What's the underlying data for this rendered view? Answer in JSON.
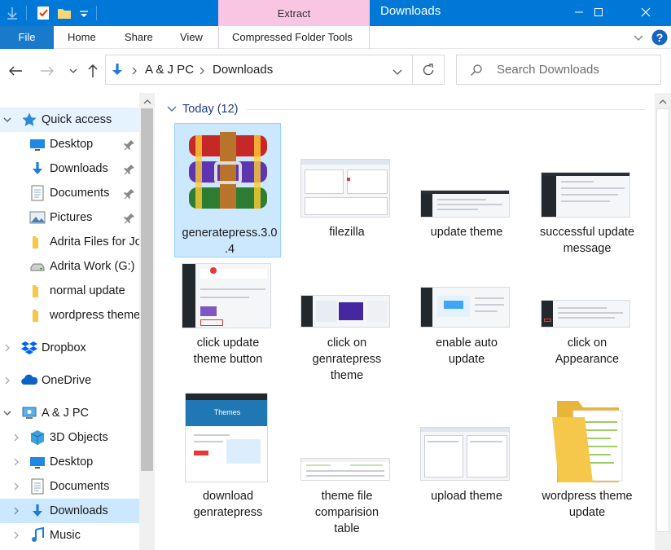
{
  "window": {
    "title": "Downloads",
    "context_tab": "Extract",
    "controls": {
      "minimize": "minimize-icon",
      "maximize": "maximize-icon",
      "close": "close-icon"
    }
  },
  "ribbon": {
    "file": "File",
    "tabs": [
      "Home",
      "Share",
      "View"
    ],
    "context_tab": "Compressed Folder Tools"
  },
  "address": {
    "path": [
      "A & J PC",
      "Downloads"
    ],
    "search_placeholder": "Search Downloads"
  },
  "nav": {
    "quick_access": "Quick access",
    "items": [
      {
        "label": "Desktop",
        "icon": "desktop-icon",
        "pinned": true
      },
      {
        "label": "Downloads",
        "icon": "download-arrow-icon",
        "pinned": true
      },
      {
        "label": "Documents",
        "icon": "documents-icon",
        "pinned": true
      },
      {
        "label": "Pictures",
        "icon": "pictures-icon",
        "pinned": true
      },
      {
        "label": "Adrita Files for Jo",
        "icon": "folder-icon",
        "pinned": false
      },
      {
        "label": "Adrita Work (G:)",
        "icon": "drive-icon",
        "pinned": false
      },
      {
        "label": "normal update",
        "icon": "folder-icon",
        "pinned": false
      },
      {
        "label": "wordpress theme",
        "icon": "folder-icon",
        "pinned": false
      }
    ],
    "dropbox": "Dropbox",
    "onedrive": "OneDrive",
    "this_pc": "A & J PC",
    "pc_items": [
      {
        "label": "3D Objects",
        "icon": "3d-objects-icon"
      },
      {
        "label": "Desktop",
        "icon": "desktop-icon"
      },
      {
        "label": "Documents",
        "icon": "documents-icon"
      },
      {
        "label": "Downloads",
        "icon": "download-arrow-icon"
      },
      {
        "label": "Music",
        "icon": "music-icon"
      }
    ]
  },
  "content": {
    "group": "Today (12)",
    "files": [
      {
        "name": "generatepress.3.0.4",
        "lines": [
          "generatepress.3.0",
          ".4"
        ],
        "kind": "winrar"
      },
      {
        "name": "filezilla",
        "lines": [
          "filezilla"
        ],
        "kind": "shot-light"
      },
      {
        "name": "update theme",
        "lines": [
          "update theme"
        ],
        "kind": "shot-wp"
      },
      {
        "name": "successful update message",
        "lines": [
          "successful update",
          "message"
        ],
        "kind": "shot-wp"
      },
      {
        "name": "click update theme button",
        "lines": [
          "click update",
          "theme button"
        ],
        "kind": "shot-wp-tall"
      },
      {
        "name": "click on genratepress theme",
        "lines": [
          "click on",
          "genratepress",
          "theme"
        ],
        "kind": "shot-purple"
      },
      {
        "name": "enable auto update",
        "lines": [
          "enable auto",
          "update"
        ],
        "kind": "shot-wp-blue"
      },
      {
        "name": "click on Appearance",
        "lines": [
          "click on",
          "Appearance"
        ],
        "kind": "shot-wp"
      },
      {
        "name": "download genratepress",
        "lines": [
          "download",
          "genratepress"
        ],
        "kind": "shot-themes"
      },
      {
        "name": "theme file comparision table",
        "lines": [
          "theme file",
          "comparision",
          "table"
        ],
        "kind": "shot-table"
      },
      {
        "name": "upload theme",
        "lines": [
          "upload theme"
        ],
        "kind": "shot-light"
      },
      {
        "name": "wordpress theme update",
        "lines": [
          "wordpress theme",
          "update"
        ],
        "kind": "folder"
      }
    ],
    "themes_heading": "Themes"
  },
  "colors": {
    "titlebar": "#0078d7",
    "extract": "#f8c6e2",
    "selection": "#cce8ff",
    "folder": "#f5c84b"
  }
}
